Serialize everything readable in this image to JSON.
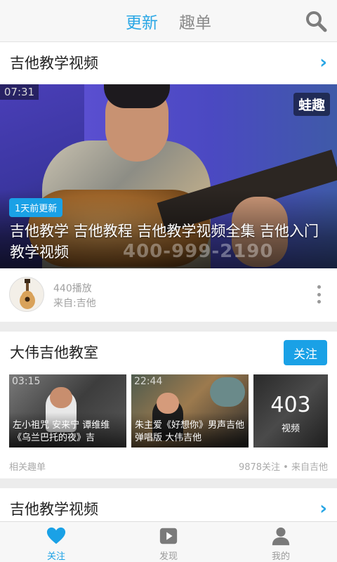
{
  "header": {
    "tabs": [
      "更新",
      "趣单"
    ],
    "active_tab": 0
  },
  "feed_card": {
    "section_title": "吉他教学视频",
    "video": {
      "duration": "07:31",
      "watermark": "蛙趣",
      "overlay_phone": "400-999-2190",
      "badge": "1天前更新",
      "title": "吉他教学 吉他教程 吉他教学视频全集 吉他入门教学视频"
    },
    "play_count": "440播放",
    "source": "来自:吉他"
  },
  "channel_card": {
    "title": "大伟吉他教室",
    "follow_label": "关注",
    "thumbs": [
      {
        "duration": "03:15",
        "caption": "左小祖咒 安来宁 谭维维《乌兰巴托的夜》吉"
      },
      {
        "duration": "22:44",
        "caption": "朱主爱《好想你》男声吉他弹唱版 大伟吉他"
      }
    ],
    "video_count": "403",
    "video_count_label": "视频",
    "footer_left": "相关趣单",
    "footer_right": "9878关注 • 来自吉他"
  },
  "third_card": {
    "section_title": "吉他教学视频"
  },
  "bottom_nav": {
    "items": [
      {
        "label": "关注",
        "icon": "heart-icon",
        "active": true
      },
      {
        "label": "发现",
        "icon": "play-icon",
        "active": false
      },
      {
        "label": "我的",
        "icon": "person-icon",
        "active": false
      }
    ]
  },
  "colors": {
    "accent": "#1aa1e6",
    "tab_active": "#28a6e5",
    "muted": "#9a9a9a"
  }
}
